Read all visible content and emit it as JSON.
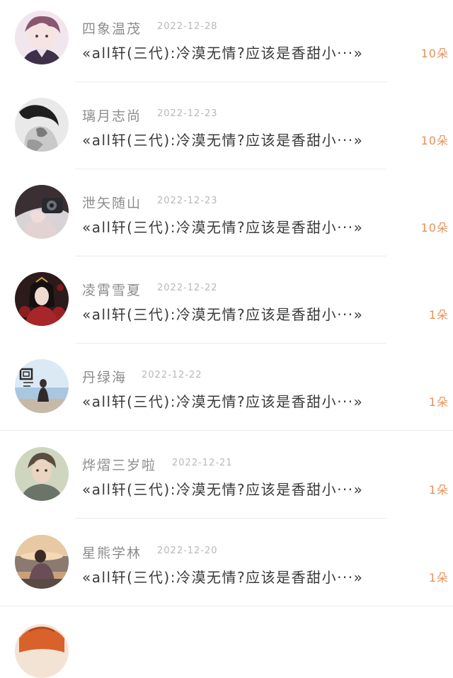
{
  "items": [
    {
      "name": "四象温茂",
      "date": "2022-12-28",
      "title": "«all轩(三代):冷漠无情?应该是香甜小···»",
      "count": "10朵",
      "avatar": "anime-boy-avatar"
    },
    {
      "name": "璃月志尚",
      "date": "2022-12-23",
      "title": "«all轩(三代):冷漠无情?应该是香甜小···»",
      "count": "10朵",
      "avatar": "bw-portrait-avatar"
    },
    {
      "name": "泄矢随山",
      "date": "2022-12-23",
      "title": "«all轩(三代):冷漠无情?应该是香甜小···»",
      "count": "10朵",
      "avatar": "camera-girl-avatar"
    },
    {
      "name": "凌霄雪夏",
      "date": "2022-12-22",
      "title": "«all轩(三代):冷漠无情?应该是香甜小···»",
      "count": "1朵",
      "avatar": "red-dress-girl-avatar"
    },
    {
      "name": "丹绿海",
      "date": "2022-12-22",
      "title": "«all轩(三代):冷漠无情?应该是香甜小···»",
      "count": "1朵",
      "avatar": "seaside-girl-avatar"
    },
    {
      "name": "烨熠三岁啦",
      "date": "2022-12-21",
      "title": "«all轩(三代):冷漠无情?应该是香甜小···»",
      "count": "1朵",
      "avatar": "young-man-avatar"
    },
    {
      "name": "星熊学林",
      "date": "2022-12-20",
      "title": "«all轩(三代):冷漠无情?应该是香甜小···»",
      "count": "1朵",
      "avatar": "sunset-girl-avatar"
    }
  ],
  "partial_item": {
    "avatar": "partial-avatar"
  }
}
